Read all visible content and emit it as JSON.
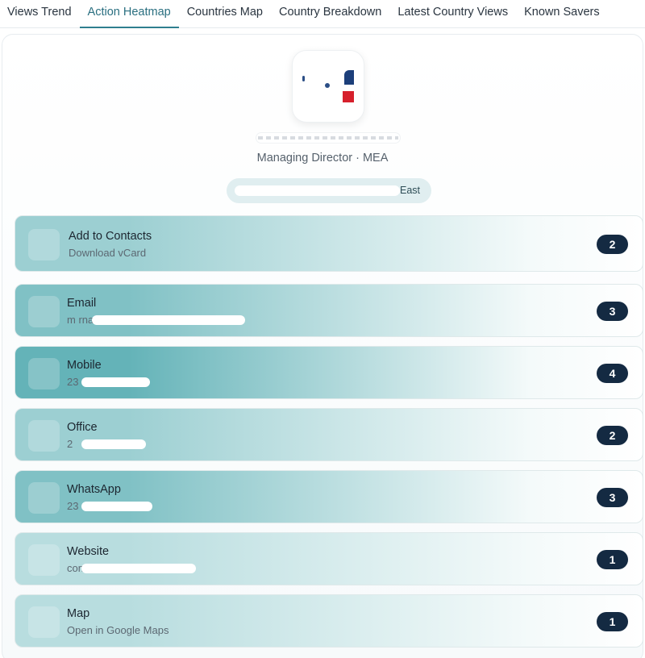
{
  "tabs": [
    {
      "label": "Views Trend",
      "active": false
    },
    {
      "label": "Action Heatmap",
      "active": true
    },
    {
      "label": "Countries Map",
      "active": false
    },
    {
      "label": "Country Breakdown",
      "active": false
    },
    {
      "label": "Latest Country Views",
      "active": false
    },
    {
      "label": "Known Savers",
      "active": false
    }
  ],
  "profile": {
    "subtitle": "Managing Director · MEA",
    "pill_visible_text": "East"
  },
  "actions": [
    {
      "label": "Add to Contacts",
      "sub": "Download vCard",
      "count": "2",
      "intensity": 0.5
    },
    {
      "label": "Email",
      "sub": "m                       rnatour@                   .com",
      "count": "3",
      "intensity": 0.75
    },
    {
      "label": "Mobile",
      "sub": "                    23",
      "count": "4",
      "intensity": 1.0
    },
    {
      "label": "Office",
      "sub": "                      2",
      "count": "2",
      "intensity": 0.5
    },
    {
      "label": "WhatsApp",
      "sub": "                    23",
      "count": "3",
      "intensity": 0.75
    },
    {
      "label": "Website",
      "sub": "                                        com/",
      "count": "1",
      "intensity": 0.25
    },
    {
      "label": "Map",
      "sub": "Open in Google Maps",
      "count": "1",
      "intensity": 0.25
    }
  ],
  "colors": {
    "accent": "#2f7f8f",
    "badge": "#142a42",
    "heat_high": "#64b3b8",
    "heat_low": "#d4ebec"
  }
}
